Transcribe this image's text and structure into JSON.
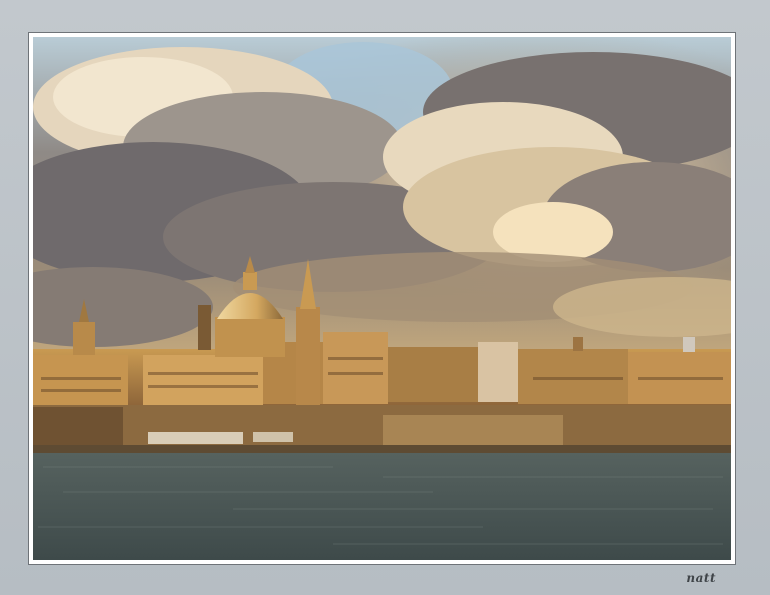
{
  "image": {
    "subject": "city-skyline-with-dome-and-spire-across-water",
    "colors": {
      "mat": "#b9c0c6",
      "frame_border": "#6e7378",
      "sky_blue": "#a9c6d8",
      "cloud_light": "#e9d8b8",
      "cloud_dark": "#5c5a60",
      "stone_lit": "#c99a52",
      "stone_shadow": "#6d4f2e",
      "water": "#4a5654"
    }
  },
  "signature": "natt"
}
